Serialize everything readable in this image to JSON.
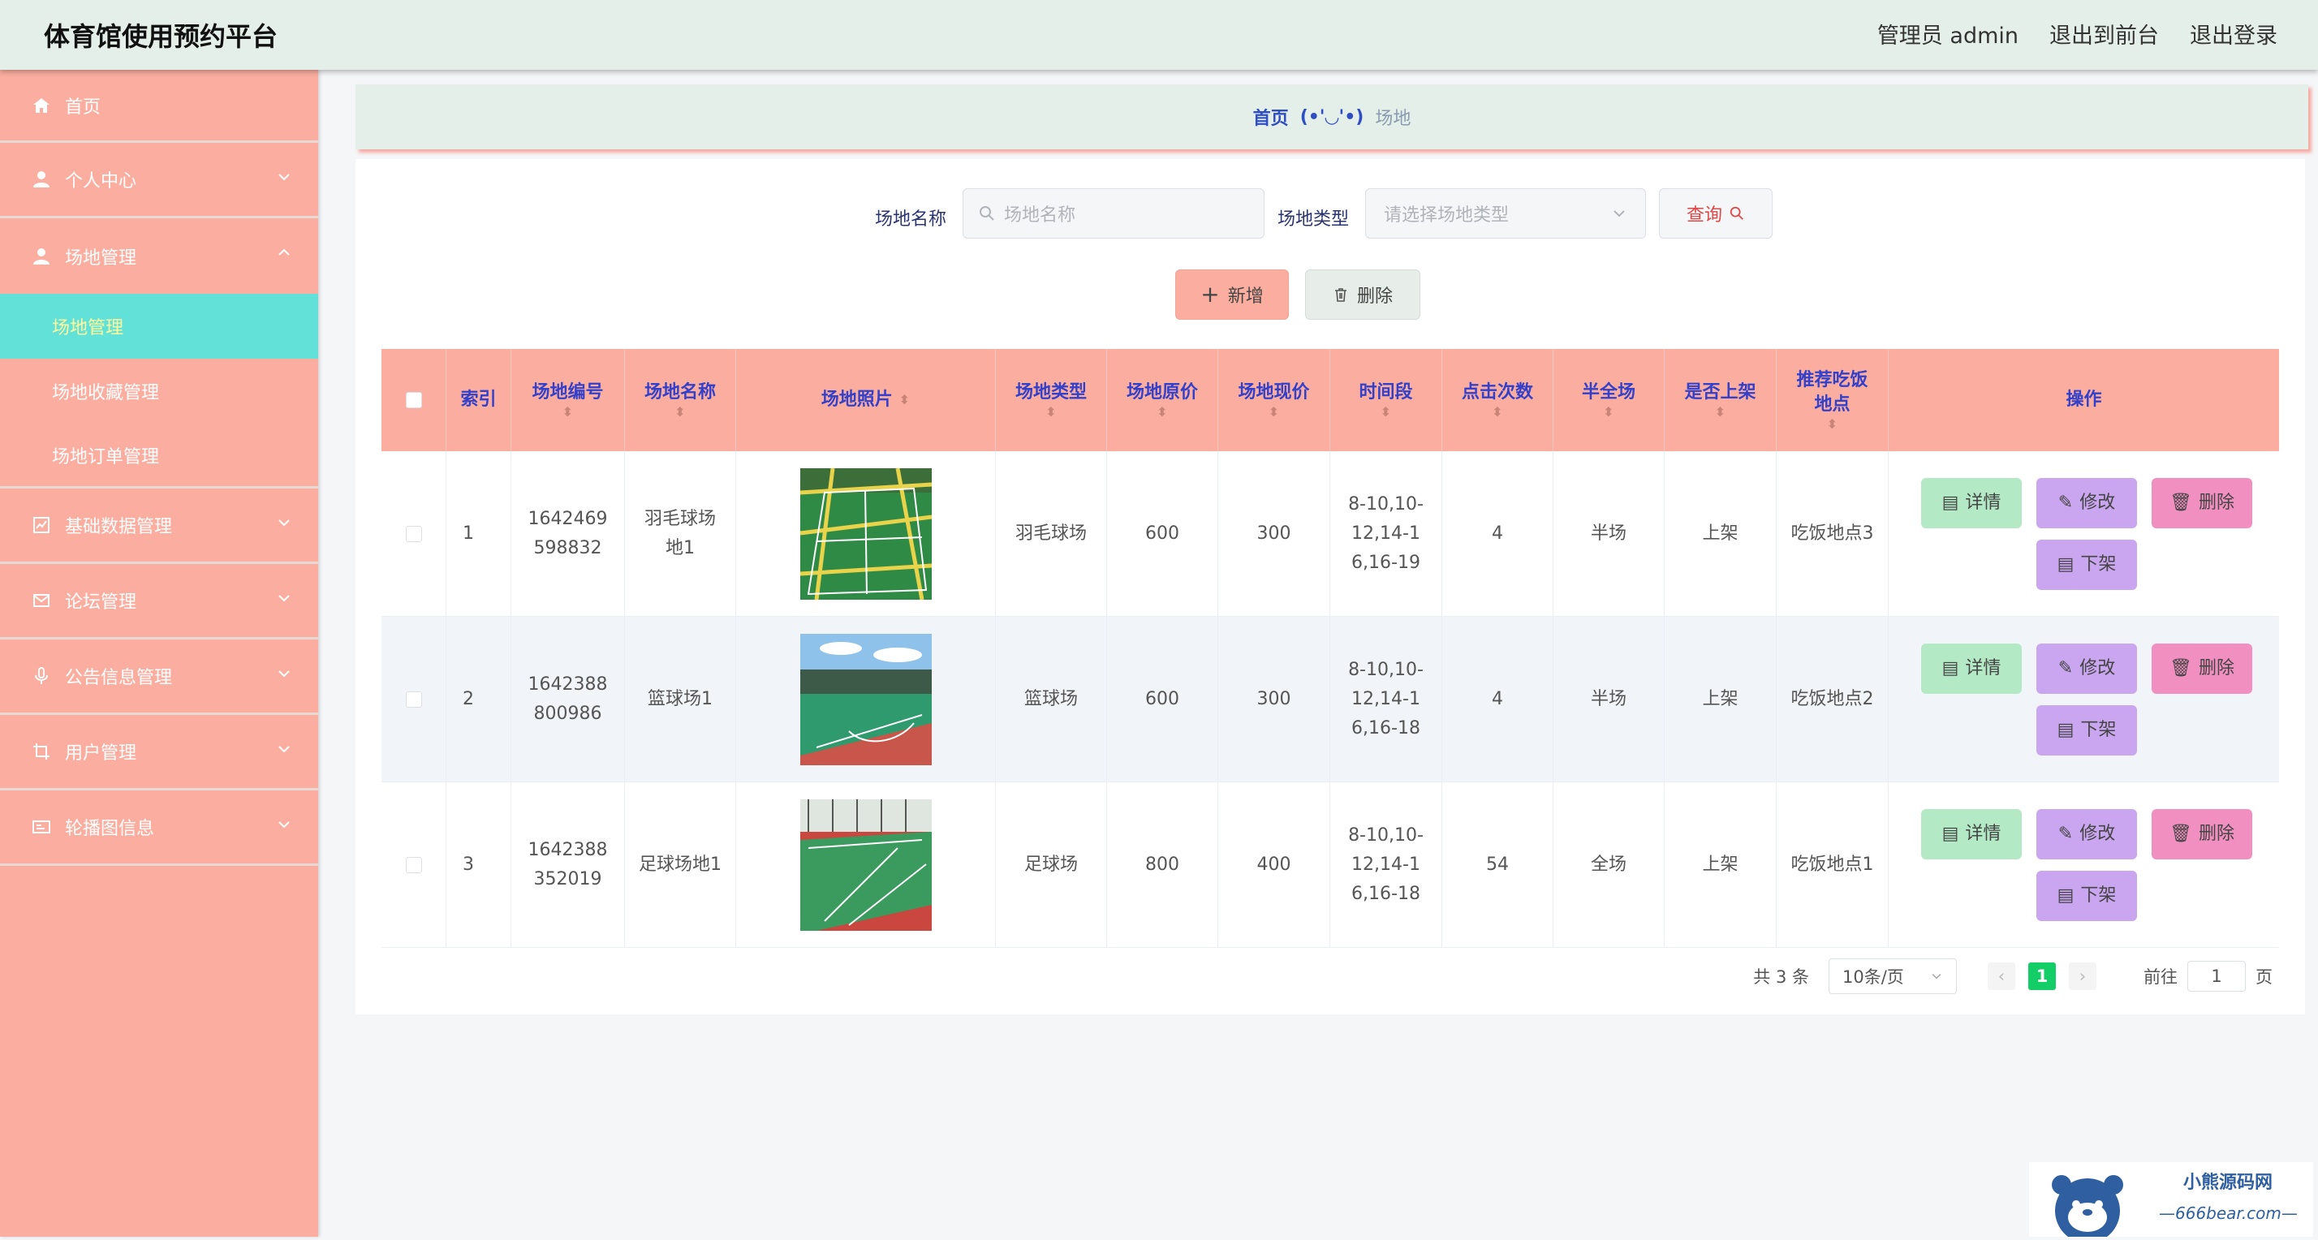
{
  "app": {
    "title": "体育馆使用预约平台"
  },
  "topnav": {
    "user": "管理员 admin",
    "to_front": "退出到前台",
    "logout": "退出登录"
  },
  "sidebar": {
    "items": [
      {
        "label": "首页",
        "icon": "home-icon"
      },
      {
        "label": "个人中心",
        "icon": "user-icon"
      },
      {
        "label": "场地管理",
        "icon": "user-icon"
      },
      {
        "label": "基础数据管理",
        "icon": "chart-icon"
      },
      {
        "label": "论坛管理",
        "icon": "mail-icon"
      },
      {
        "label": "公告信息管理",
        "icon": "mic-icon"
      },
      {
        "label": "用户管理",
        "icon": "crop-icon"
      },
      {
        "label": "轮播图信息",
        "icon": "card-icon"
      }
    ],
    "submenu": [
      "场地管理",
      "场地收藏管理",
      "场地订单管理"
    ]
  },
  "breadcrumb": {
    "home": "首页",
    "separator": "(•'◡'•)",
    "current": "场地"
  },
  "search": {
    "name_label": "场地名称",
    "name_placeholder": "场地名称",
    "type_label": "场地类型",
    "type_placeholder": "请选择场地类型",
    "query_button": "查询"
  },
  "actions": {
    "add": "新增",
    "delete": "删除"
  },
  "table": {
    "headers": {
      "index": "索引",
      "code": "场地编号",
      "name": "场地名称",
      "photo": "场地照片",
      "type": "场地类型",
      "orig_price": "场地原价",
      "cur_price": "场地现价",
      "time": "时间段",
      "clicks": "点击次数",
      "half": "半全场",
      "listed": "是否上架",
      "food": "推荐吃饭地点",
      "ops": "操作"
    },
    "rows": [
      {
        "index": "1",
        "code": "1642469598832",
        "name": "羽毛球场地1",
        "type": "羽毛球场",
        "orig_price": "600",
        "cur_price": "300",
        "time": "8-10,10-12,14-16,16-19",
        "clicks": "4",
        "half": "半场",
        "listed": "上架",
        "food": "吃饭地点3"
      },
      {
        "index": "2",
        "code": "1642388800986",
        "name": "篮球场1",
        "type": "篮球场",
        "orig_price": "600",
        "cur_price": "300",
        "time": "8-10,10-12,14-16,16-18",
        "clicks": "4",
        "half": "半场",
        "listed": "上架",
        "food": "吃饭地点2"
      },
      {
        "index": "3",
        "code": "1642388352019",
        "name": "足球场地1",
        "type": "足球场",
        "orig_price": "800",
        "cur_price": "400",
        "time": "8-10,10-12,14-16,16-18",
        "clicks": "54",
        "half": "全场",
        "listed": "上架",
        "food": "吃饭地点1"
      }
    ],
    "row_buttons": {
      "detail": "详情",
      "edit": "修改",
      "delete": "删除",
      "offshelf": "下架"
    }
  },
  "pagination": {
    "total": "共 3 条",
    "page_size": "10条/页",
    "current": "1",
    "goto": "前往",
    "goto_value": "1",
    "page_unit": "页"
  },
  "colors": {
    "sidebar": "#fbaea0",
    "topbar": "#e4efe9",
    "active": "#62e1d8",
    "header_text": "#3340c9"
  }
}
